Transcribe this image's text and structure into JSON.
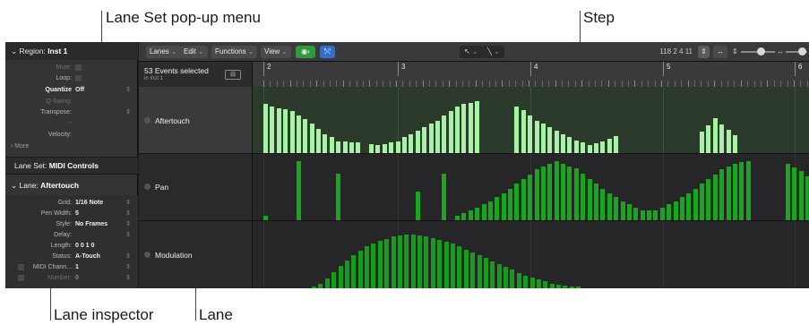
{
  "callouts": {
    "lane_set": "Lane Set pop-up menu",
    "step": "Step",
    "lane_inspector": "Lane inspector",
    "lane": "Lane"
  },
  "inspector": {
    "region_label": "Region:",
    "region_name": "Inst 1",
    "rows": {
      "mute": "Mute:",
      "loop": "Loop:",
      "quantize_label": "Quantize",
      "quantize_value": "Off",
      "q_swing": "Q-Swing:",
      "transpose": "Transpose:",
      "velocity": "Velocity:",
      "dash": "--"
    },
    "more": "More",
    "lane_set_label": "Lane Set:",
    "lane_set_value": "MIDI Controls",
    "lane_label": "Lane:",
    "lane_value": "Aftertouch",
    "lane_rows": [
      {
        "key": "Grid:",
        "value": "1/16 Note"
      },
      {
        "key": "Pen Width:",
        "value": "5"
      },
      {
        "key": "Style:",
        "value": "No Frames"
      },
      {
        "key": "Delay:",
        "value": ""
      },
      {
        "key": "Length:",
        "value": "0 0 1     0"
      },
      {
        "key": "Status:",
        "value": "A-Touch"
      },
      {
        "key": "MIDI Chann...",
        "value": "1"
      },
      {
        "key": "Number:",
        "value": "0"
      }
    ]
  },
  "toolbar": {
    "menus": [
      "Lanes",
      "Edit",
      "Functions",
      "View"
    ],
    "pointer_tool": "↖",
    "pencil_tool": "╲",
    "position": "118  2 4 11"
  },
  "header": {
    "events_selected": "53 Events selected",
    "region_sub": "in Inst 1",
    "bars": [
      "2",
      "3",
      "4",
      "5",
      "6"
    ]
  },
  "lanes": [
    {
      "name": "Aftertouch"
    },
    {
      "name": "Pan"
    },
    {
      "name": "Modulation"
    }
  ],
  "colors": {
    "aftertouch_bar": "#a8f2a8",
    "pan_bar": "#1aa51e",
    "mod_bar": "#169c1a",
    "selected_lane_bg": "#3c5a3c"
  },
  "chart_data": {
    "type": "bar",
    "lane_scale_max": 127,
    "series": [
      {
        "name": "Aftertouch",
        "values": [
          103,
          97,
          94,
          91,
          87,
          79,
          71,
          61,
          50,
          40,
          33,
          25,
          25,
          22,
          22,
          0,
          18,
          17,
          18,
          22,
          25,
          33,
          40,
          47,
          54,
          61,
          68,
          79,
          87,
          97,
          103,
          105,
          108,
          0,
          0,
          0,
          0,
          0,
          98,
          90,
          79,
          68,
          61,
          54,
          47,
          40,
          33,
          26,
          22,
          17,
          20,
          24,
          30,
          35,
          0,
          0,
          0,
          0,
          0,
          0,
          0,
          0,
          0,
          0,
          0,
          0,
          45,
          58,
          72,
          60,
          48,
          38
        ]
      },
      {
        "name": "Pan",
        "values": [
          10,
          0,
          0,
          0,
          0,
          123,
          0,
          0,
          0,
          0,
          0,
          98,
          0,
          0,
          0,
          0,
          0,
          0,
          0,
          0,
          0,
          0,
          0,
          60,
          0,
          0,
          0,
          98,
          0,
          10,
          15,
          20,
          26,
          33,
          40,
          48,
          56,
          66,
          76,
          86,
          96,
          106,
          112,
          118,
          124,
          118,
          112,
          108,
          98,
          86,
          76,
          66,
          56,
          48,
          40,
          33,
          26,
          20,
          20,
          20,
          26,
          33,
          40,
          48,
          56,
          66,
          76,
          86,
          96,
          106,
          112,
          118,
          122,
          124,
          0,
          0,
          0,
          0,
          0,
          118,
          110,
          102,
          92,
          80,
          68,
          56,
          44,
          34,
          24,
          18,
          10
        ]
      },
      {
        "name": "Modulation",
        "values": [
          4,
          10,
          20,
          34,
          46,
          58,
          68,
          78,
          86,
          92,
          98,
          102,
          106,
          108,
          110,
          110,
          108,
          106,
          104,
          100,
          96,
          92,
          86,
          80,
          74,
          68,
          62,
          56,
          50,
          44,
          38,
          32,
          26,
          22,
          18,
          14,
          10,
          8,
          6,
          4,
          2
        ]
      }
    ]
  }
}
